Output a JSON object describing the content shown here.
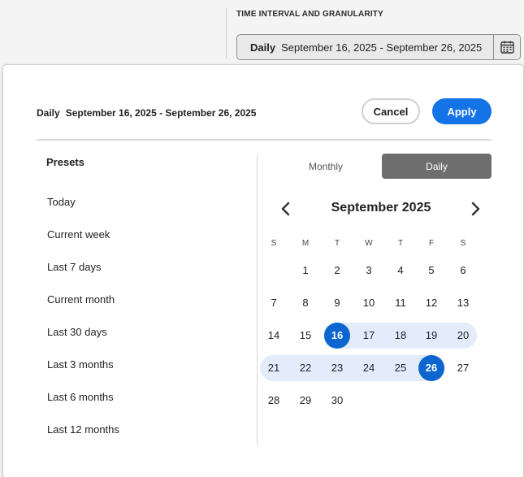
{
  "field": {
    "label": "TIME INTERVAL AND GRANULARITY",
    "granularity": "Daily",
    "range": "September 16, 2025 - September 26, 2025",
    "calendar_icon": "calendar-icon"
  },
  "popover": {
    "granularity": "Daily",
    "range": "September 16, 2025 - September 26, 2025",
    "cancel_label": "Cancel",
    "apply_label": "Apply",
    "apply_color": "#1473e6"
  },
  "presets": {
    "title": "Presets",
    "items": [
      "Today",
      "Current week",
      "Last 7 days",
      "Current month",
      "Last 30 days",
      "Last 3 months",
      "Last 6 months",
      "Last 12 months"
    ]
  },
  "toggle": {
    "monthly": "Monthly",
    "daily": "Daily",
    "active": "Daily"
  },
  "calendar": {
    "month_title": "September 2025",
    "weekdays": [
      "S",
      "M",
      "T",
      "W",
      "T",
      "F",
      "S"
    ],
    "weeks": [
      [
        "",
        "1",
        "2",
        "3",
        "4",
        "5",
        "6"
      ],
      [
        "7",
        "8",
        "9",
        "10",
        "11",
        "12",
        "13"
      ],
      [
        "14",
        "15",
        "16",
        "17",
        "18",
        "19",
        "20"
      ],
      [
        "21",
        "22",
        "23",
        "24",
        "25",
        "26",
        "27"
      ],
      [
        "28",
        "29",
        "30",
        "",
        "",
        "",
        ""
      ]
    ],
    "range_start": "16",
    "range_end": "26",
    "selected_color": "#0d66d0",
    "range_color": "#e2ecfa"
  }
}
